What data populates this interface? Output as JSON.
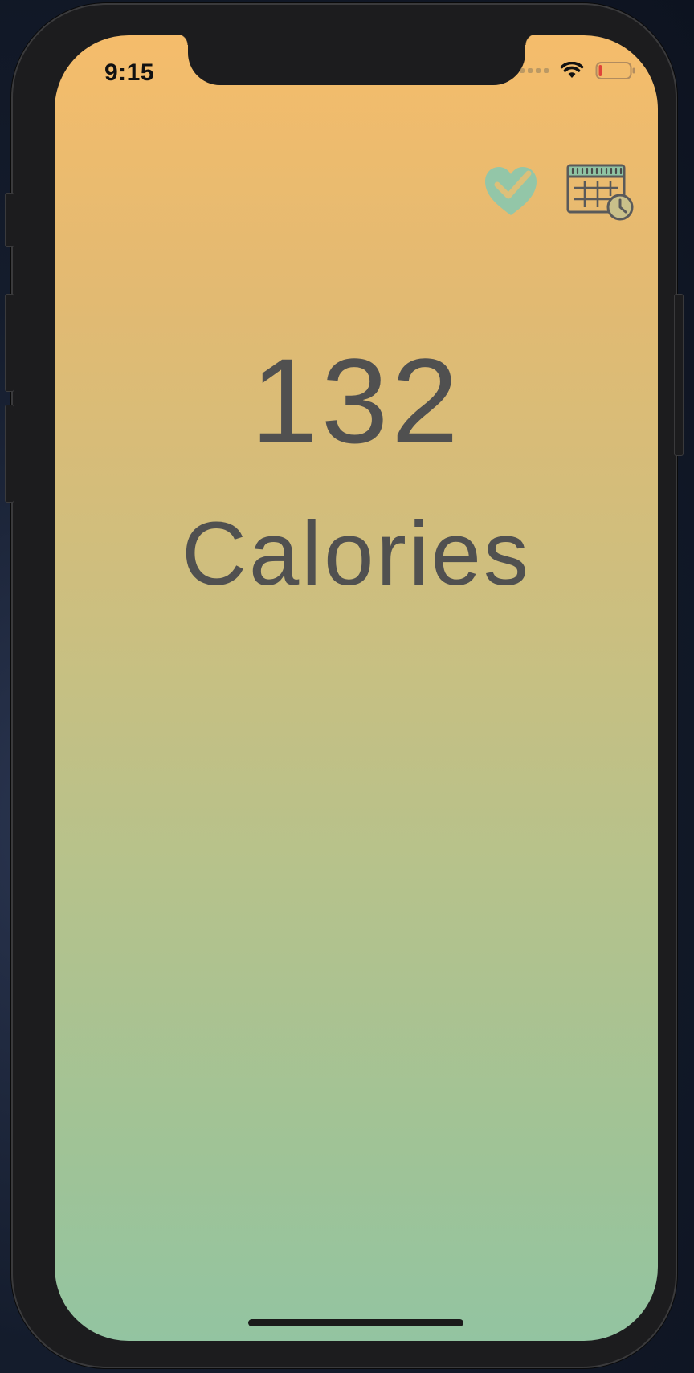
{
  "status_bar": {
    "time": "9:15"
  },
  "main": {
    "calorie_count": "132",
    "calorie_unit": "Calories"
  },
  "toolbar": {
    "health_icon": "heart-check-icon",
    "schedule_icon": "calendar-clock-icon"
  },
  "colors": {
    "gradient_top": "#f5bc6b",
    "gradient_bottom": "#93c4a1",
    "text": "#505050",
    "accent": "#93c6a8",
    "icon_stroke": "#5a5a5a",
    "battery_low": "#e0443a"
  },
  "battery": {
    "level": 0.1
  }
}
